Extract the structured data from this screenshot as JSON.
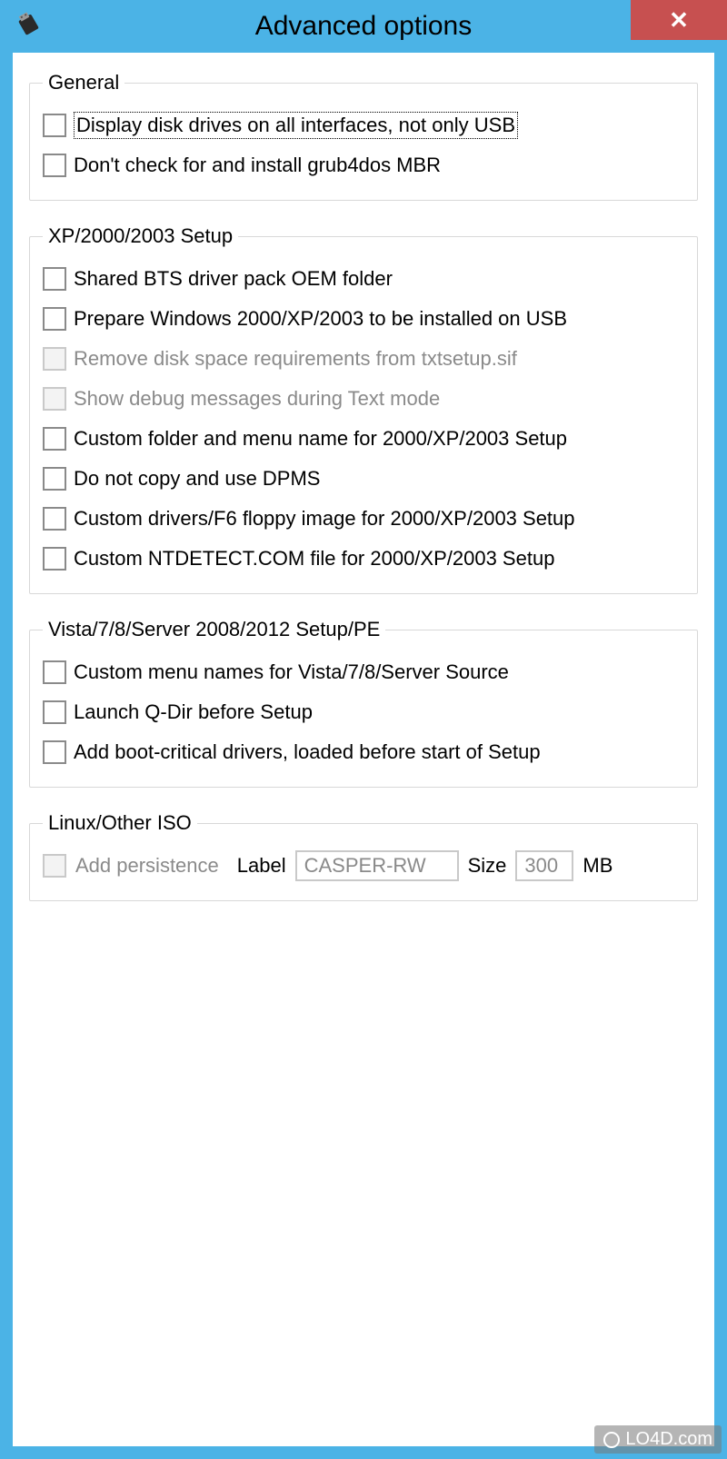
{
  "window": {
    "title": "Advanced options",
    "close_glyph": "✕"
  },
  "groups": {
    "general": {
      "legend": "General",
      "items": [
        {
          "label": "Display disk drives on all interfaces, not only USB"
        },
        {
          "label": "Don't check for and install grub4dos MBR"
        }
      ]
    },
    "xp": {
      "legend": "XP/2000/2003 Setup",
      "items": [
        {
          "label": "Shared BTS driver pack OEM folder"
        },
        {
          "label": "Prepare Windows 2000/XP/2003 to be installed on USB"
        },
        {
          "label": "Remove disk space requirements from txtsetup.sif"
        },
        {
          "label": "Show debug messages during Text mode"
        },
        {
          "label": "Custom folder and menu name for 2000/XP/2003 Setup"
        },
        {
          "label": "Do not copy and use DPMS"
        },
        {
          "label": "Custom drivers/F6 floppy image for 2000/XP/2003 Setup"
        },
        {
          "label": "Custom NTDETECT.COM file for 2000/XP/2003 Setup"
        }
      ]
    },
    "vista": {
      "legend": "Vista/7/8/Server 2008/2012 Setup/PE",
      "items": [
        {
          "label": "Custom menu names for Vista/7/8/Server Source"
        },
        {
          "label": "Launch Q-Dir before Setup"
        },
        {
          "label": "Add boot-critical drivers, loaded before start of Setup"
        }
      ]
    },
    "linux": {
      "legend": "Linux/Other ISO",
      "persistence_label": "Add persistence",
      "label_text": "Label",
      "label_value": "CASPER-RW",
      "size_text": "Size",
      "size_value": "300",
      "size_unit": "MB"
    }
  },
  "watermark": "LO4D.com"
}
